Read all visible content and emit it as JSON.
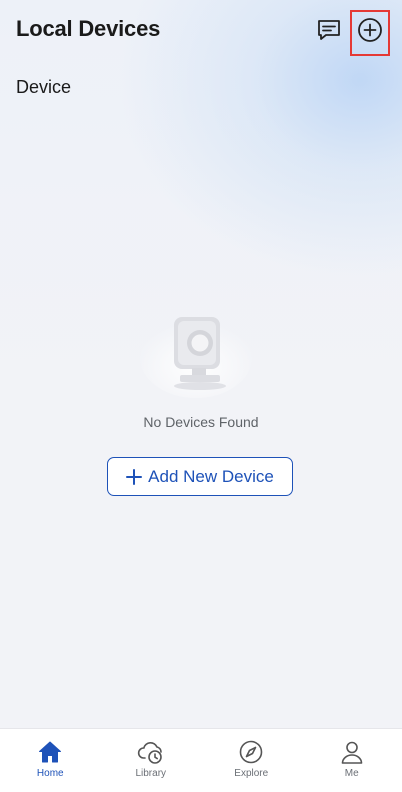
{
  "header": {
    "title": "Local Devices"
  },
  "section": {
    "label": "Device"
  },
  "empty_state": {
    "message": "No Devices Found",
    "button_label": "Add New Device"
  },
  "tabbar": {
    "active": "Home",
    "tabs": [
      {
        "label": "Home",
        "icon": "home-icon"
      },
      {
        "label": "Library",
        "icon": "cloud-clock-icon"
      },
      {
        "label": "Explore",
        "icon": "compass-icon"
      },
      {
        "label": "Me",
        "icon": "person-icon"
      }
    ]
  },
  "colors": {
    "accent": "#1e52b8",
    "highlight": "#e53935",
    "background": "#f2f3f7"
  }
}
